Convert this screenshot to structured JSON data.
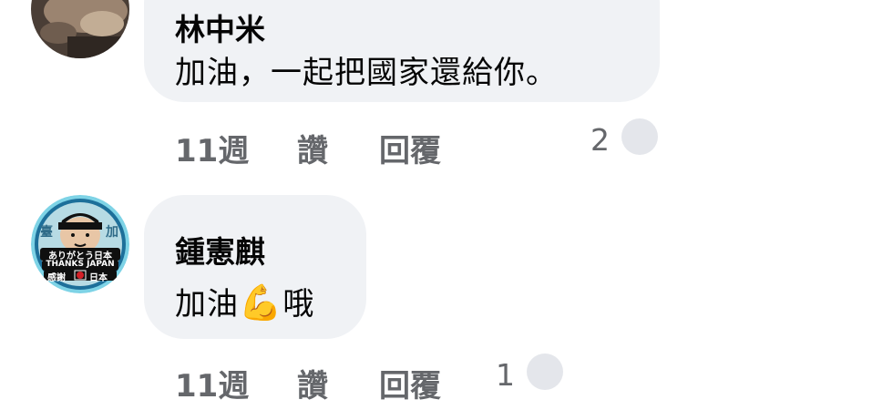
{
  "comments": [
    {
      "author": "林中米",
      "text": "加油，一起把國家還給你。",
      "time": "11週",
      "like_label": "讚",
      "reply_label": "回覆",
      "reaction_count": "2"
    },
    {
      "author": "鍾憲麒",
      "text_before": "加油",
      "emoji": "💪",
      "text_after": "哦",
      "time": "11週",
      "like_label": "讚",
      "reply_label": "回覆",
      "reaction_count": "1",
      "avatar_text": {
        "line1": "ありがとう日本",
        "line2": "THANKS JAPAN",
        "line3_left": "感謝",
        "line3_right": "日本",
        "top_left": "臺",
        "top_right": "加"
      }
    }
  ],
  "colors": {
    "bubble": "#f0f2f5",
    "meta_text": "#65676b",
    "reaction_circle": "#e4e6eb"
  },
  "icons": {
    "emoji": "flexed-biceps-emoji",
    "reaction": "reaction-placeholder-icon"
  }
}
